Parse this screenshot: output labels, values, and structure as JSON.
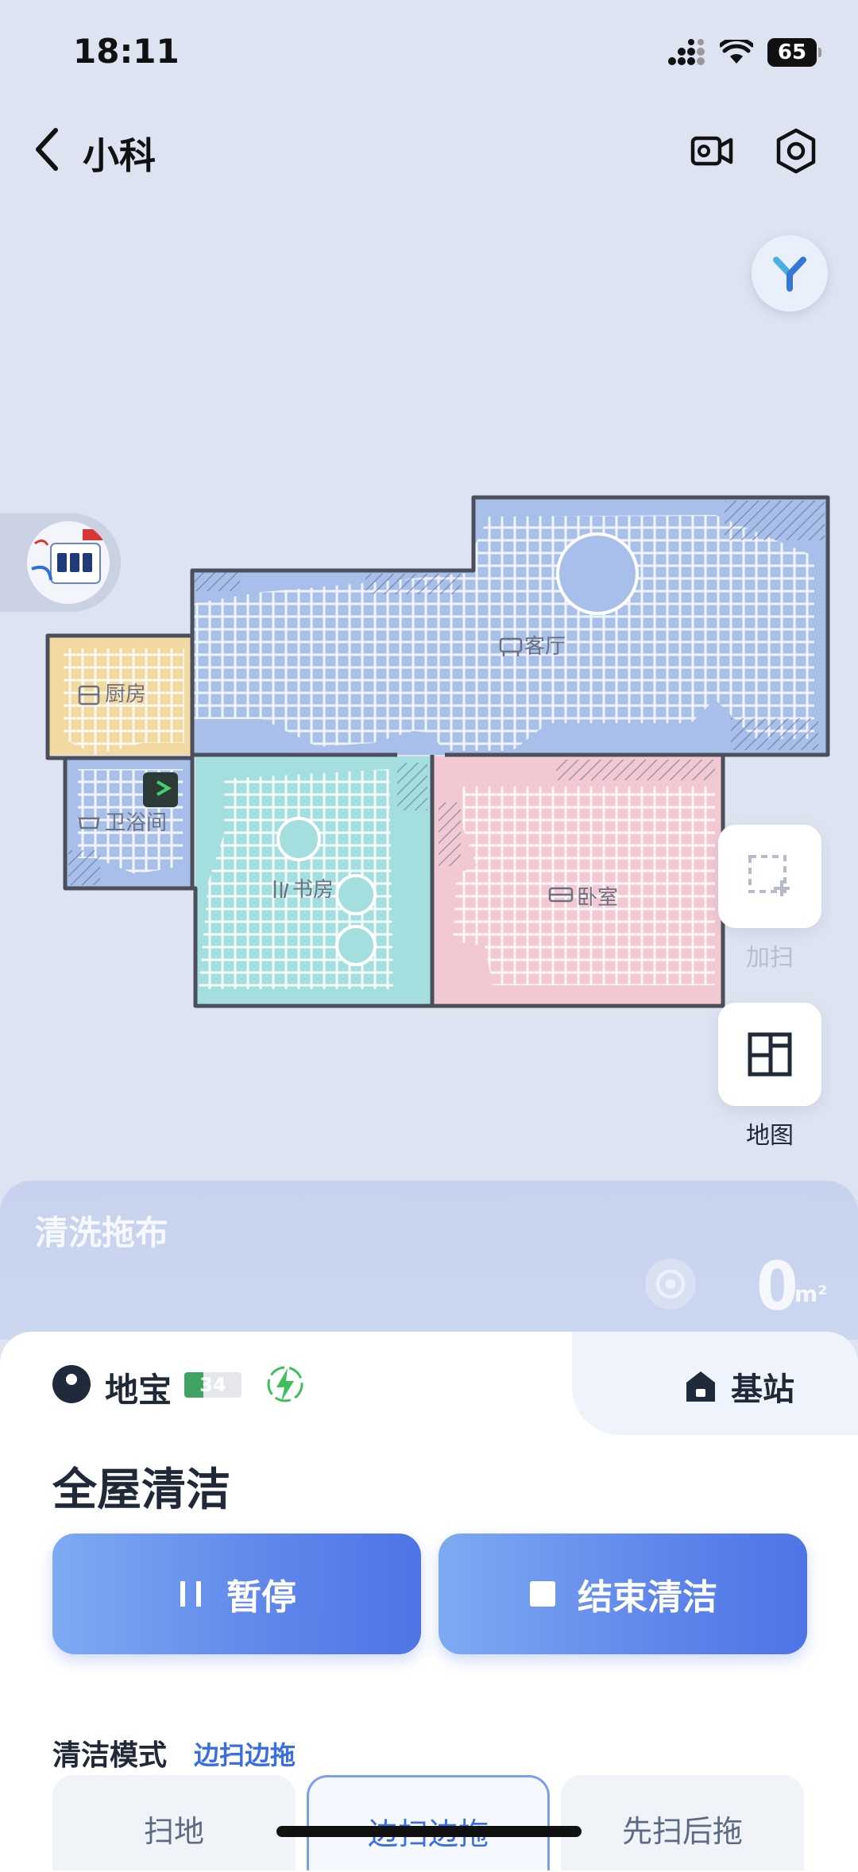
{
  "status_bar": {
    "time": "18:11",
    "battery": "65"
  },
  "header": {
    "title": "小科"
  },
  "map": {
    "rooms": {
      "living_room": "客厅",
      "kitchen": "厨房",
      "bathroom": "卫浴间",
      "study": "书房",
      "bedroom": "卧室"
    },
    "colors": {
      "living_room": "#a8bfea",
      "kitchen": "#f2d9a2",
      "bathroom": "#a8bfea",
      "study": "#a5dede",
      "bedroom": "#f2c9d3",
      "outline": "#4a4f5a"
    }
  },
  "side_actions": {
    "add_label": "加扫",
    "map_label": "地图"
  },
  "wash": {
    "title": "清洗拖布",
    "area_value": "0",
    "area_unit": "m²"
  },
  "device": {
    "name": "地宝",
    "battery": "34",
    "battery_level": 0.34,
    "base_label": "基站"
  },
  "cleaning": {
    "title": "全屋清洁",
    "pause_label": "暂停",
    "stop_label": "结束清洁"
  },
  "modes": {
    "title": "清洁模式",
    "current": "边扫边拖",
    "options": [
      "扫地",
      "边扫边拖",
      "先扫后拖"
    ],
    "active_index": 1
  }
}
